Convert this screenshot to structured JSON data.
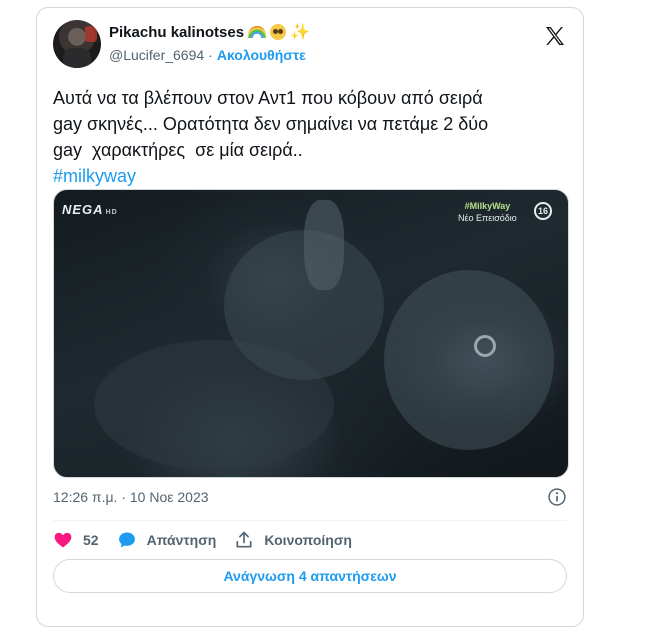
{
  "user": {
    "display_name": "Pikachu kalinotses",
    "emojis": [
      "rainbow",
      "pleading-face",
      "sparkles"
    ],
    "handle": "@Lucifer_6694",
    "separator": "·",
    "follow_label": "Ακολουθήστε"
  },
  "tweet": {
    "lines": [
      "Αυτά να τα βλέπουν στον Αντ1 που κόβουν από σειρά",
      "gay σκηνές... Ορατότητα δεν σημαίνει να πετάμε 2 δύο",
      "gay  χαρακτήρες  σε μία σειρά.."
    ],
    "hashtag": "#milkyway"
  },
  "media": {
    "channel_logo": "NEGA",
    "channel_hd": "HD",
    "overlay_tag": "#MilkyWay",
    "overlay_sub": "Νέο Επεισόδιο",
    "age_rating": "16"
  },
  "meta": {
    "time": "12:26 π.μ.",
    "dot": "·",
    "date": "10 Νοε 2023"
  },
  "actions": {
    "likes_count": "52",
    "reply_label": "Απάντηση",
    "share_label": "Κοινοποίηση"
  },
  "read_replies_label": "Ανάγνωση 4 απαντήσεων",
  "colors": {
    "accent": "#1d9bf0",
    "heart": "#f91880",
    "text": "#0f1419",
    "muted": "#536471",
    "border": "#cfd9de"
  },
  "icons": {
    "brand": "x-logo-icon",
    "info": "info-icon",
    "like": "heart-icon",
    "reply": "speech-bubble-icon",
    "share": "share-upload-icon"
  }
}
